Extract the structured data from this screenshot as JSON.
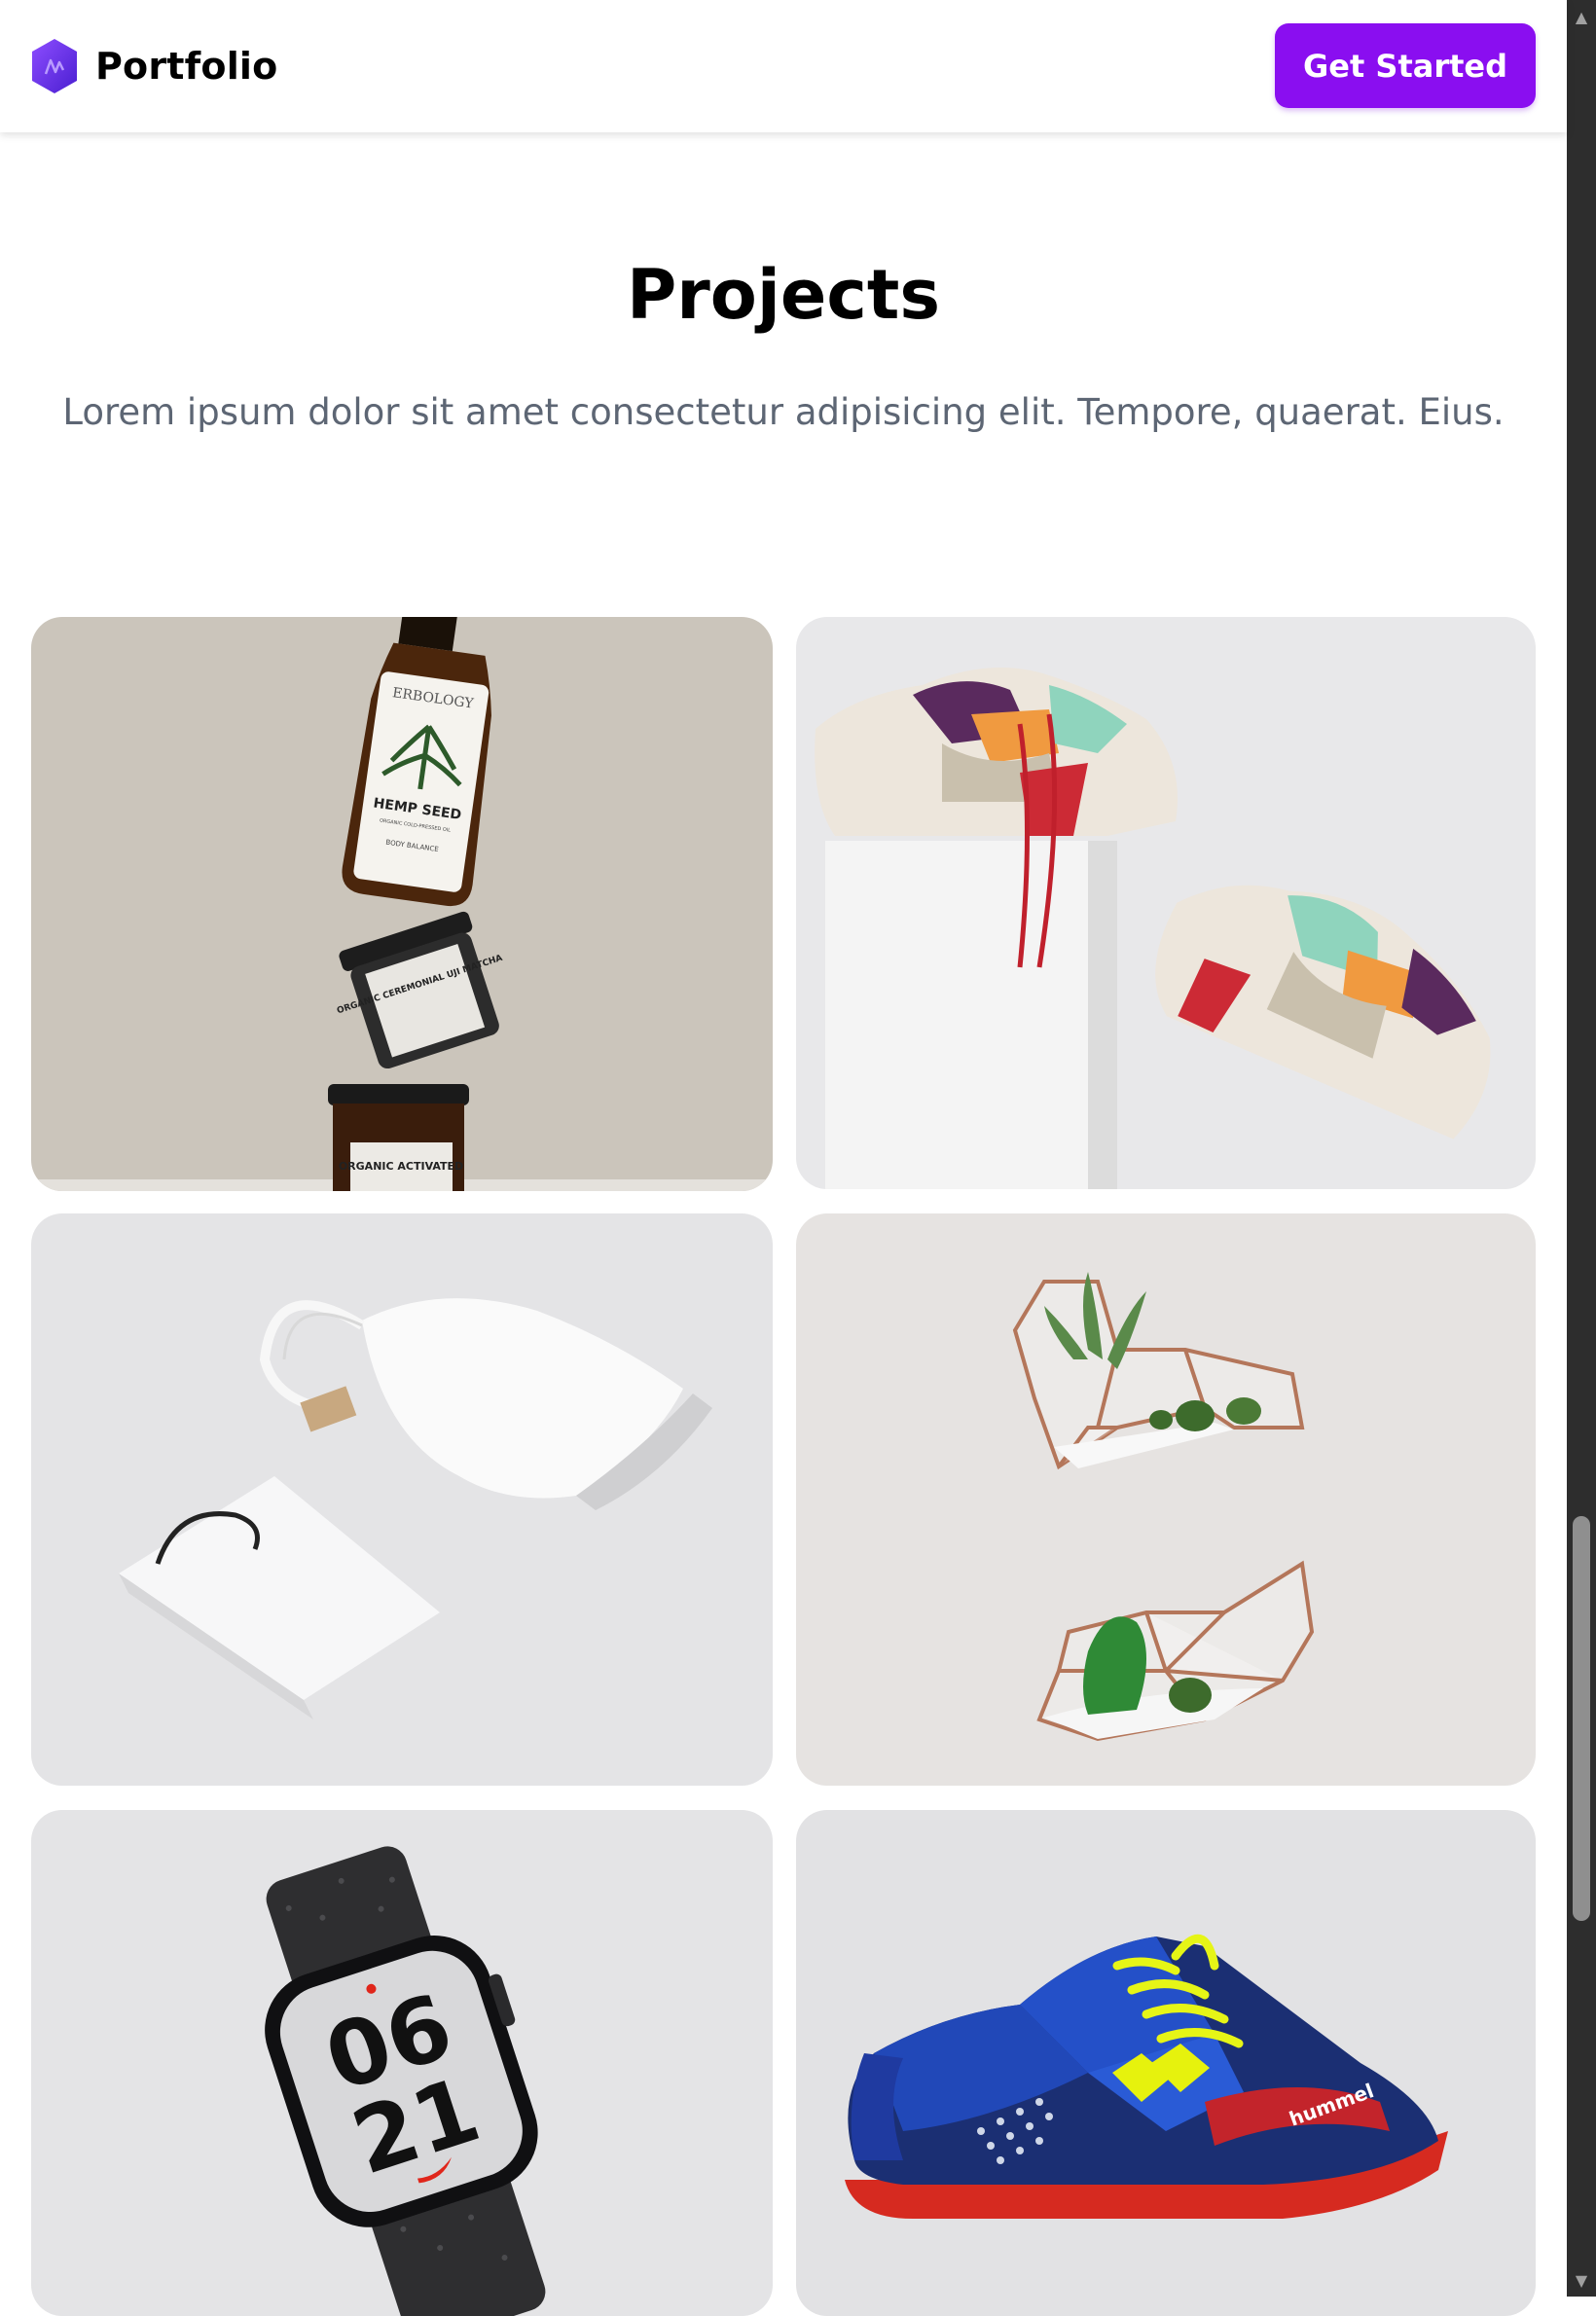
{
  "header": {
    "brand_name": "Portfolio",
    "logo_icon": "hexagon-logo-icon",
    "cta_label": "Get Started"
  },
  "projects": {
    "title": "Projects",
    "subtitle": "Lorem ipsum dolor sit amet consectetur adipisicing elit. Tempore, quaerat. Eius."
  },
  "items": [
    {
      "name": "hemp seed bottle and jars",
      "bottle_brand": "ERBOLOGY",
      "bottle_title": "HEMP SEED",
      "bottle_sub": "ORGANIC COLD-PRESSED OIL",
      "bottle_line": "BODY BALANCE",
      "jar_label": "ORGANIC CEREMONIAL UJI MATCHA",
      "jar2_label": "ORGANIC ACTIVATED"
    },
    {
      "name": "sneakers on white block"
    },
    {
      "name": "white pouch and paper bag mockup"
    },
    {
      "name": "geometric glass terrariums"
    },
    {
      "name": "smart watch",
      "watch_top": "06",
      "watch_bottom": "21"
    },
    {
      "name": "blue football boot",
      "shoe_brand": "hummel"
    }
  ],
  "colors": {
    "accent": "#8a0ef0",
    "subtitle": "#5d6674"
  }
}
